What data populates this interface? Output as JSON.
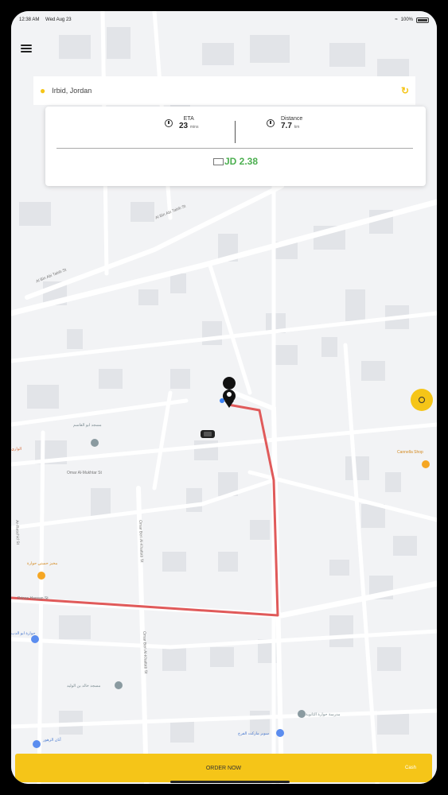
{
  "status_bar": {
    "time": "12:38 AM",
    "date": "Wed Aug 23",
    "battery": "100%"
  },
  "search": {
    "location": "Irbid, Jordan"
  },
  "trip_info": {
    "eta_label": "ETA",
    "eta_value": "23",
    "eta_unit": "mins",
    "distance_label": "Distance",
    "distance_value": "7.7",
    "distance_unit": "km",
    "price": "JD 2.38"
  },
  "map": {
    "streets": [
      "Al Bin Abi Taleb St",
      "Omar Al-Mukhtar St",
      "Ar-Raschid St",
      "Omar Ben Al-Khattab St",
      "Omar Ben Al-Khattab St",
      "Prince Hassan St"
    ],
    "pois": [
      "مسجد ابو القاسم",
      "الواري",
      "Cannella Shop",
      "مخبز حسني حوارة",
      "حوارة ابو الدب",
      "مسجد خالد بن الوليد",
      "مدرسة حوارة الثانوية",
      "سوبر ماركت الفرح",
      "أنان الزهور"
    ]
  },
  "colors": {
    "accent": "#f5c518",
    "route": "#e05a5a",
    "price": "#4caf50"
  },
  "order": {
    "label": "ORDER NOW",
    "payment": "Cash"
  }
}
